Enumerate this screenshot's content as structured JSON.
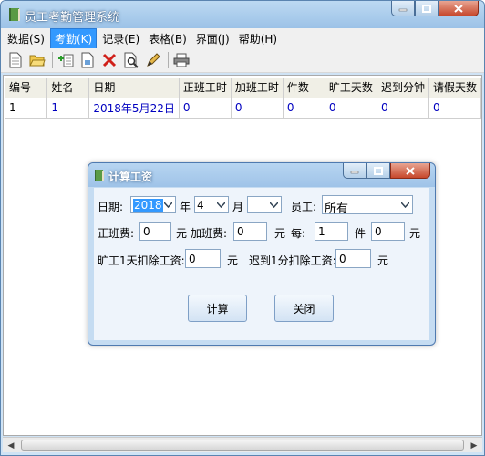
{
  "window": {
    "title": "员工考勤管理系统"
  },
  "menu": [
    {
      "label": "数据(S)",
      "active": false
    },
    {
      "label": "考勤(K)",
      "active": true
    },
    {
      "label": "记录(E)",
      "active": false
    },
    {
      "label": "表格(B)",
      "active": false
    },
    {
      "label": "界面(J)",
      "active": false
    },
    {
      "label": "帮助(H)",
      "active": false
    }
  ],
  "toolbar_icons": [
    "new-doc-icon",
    "open-folder-icon",
    "add-row-icon",
    "report-icon",
    "delete-icon",
    "preview-icon",
    "edit-pencil-icon",
    "print-icon"
  ],
  "grid": {
    "columns": [
      "编号",
      "姓名",
      "日期",
      "正班工时",
      "加班工时",
      "件数",
      "旷工天数",
      "迟到分钟",
      "请假天数"
    ],
    "rows": [
      [
        "1",
        "1",
        "2018年5月22日",
        "0",
        "0",
        "0",
        "0",
        "0",
        "0"
      ]
    ]
  },
  "dialog": {
    "title": "计算工资",
    "date_label": "日期:",
    "year_value": "2018",
    "year_unit": "年",
    "month_value": "4",
    "month_unit": "月",
    "day_value": "",
    "employee_label": "员工:",
    "employee_value": "所有",
    "regular_fee_label": "正班费:",
    "regular_fee_value": "0",
    "yuan_1": "元",
    "overtime_fee_label": "加班费:",
    "overtime_fee_value": "0",
    "yuan_2": "元",
    "per_label": "每:",
    "per_value": "1",
    "piece_unit": "件",
    "piece_fee_value": "0",
    "yuan_3": "元",
    "absence_label": "旷工1天扣除工资:",
    "absence_value": "0",
    "yuan_4": "元",
    "late_label": "迟到1分扣除工资:",
    "late_value": "0",
    "yuan_5": "元",
    "calc_button": "计算",
    "close_button": "关闭"
  },
  "colors": {
    "accent": "#3399ff",
    "link_text": "#0000c0",
    "title_bar": "#9cc2e7"
  }
}
